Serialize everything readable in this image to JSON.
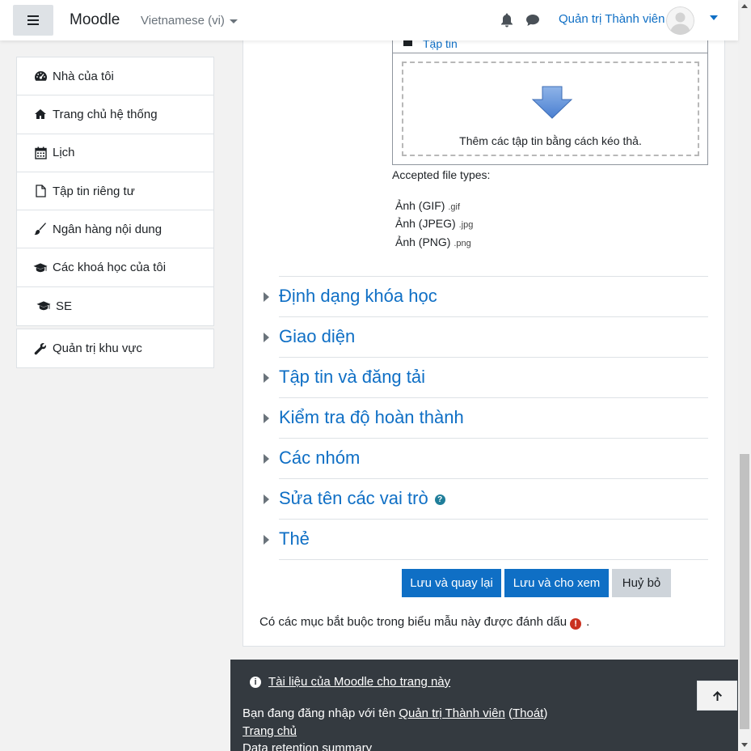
{
  "navbar": {
    "brand": "Moodle",
    "language": "Vietnamese (vi)",
    "user_name": "Quản trị Thành viên"
  },
  "drawer": {
    "items": [
      {
        "label": "Nhà của tôi",
        "icon": "dashboard-icon"
      },
      {
        "label": "Trang chủ hệ thống",
        "icon": "home-icon"
      },
      {
        "label": "Lịch",
        "icon": "calendar-icon"
      },
      {
        "label": "Tập tin riêng tư",
        "icon": "file-icon"
      },
      {
        "label": "Ngân hàng nội dung",
        "icon": "paintbrush-icon"
      },
      {
        "label": "Các khoá học của tôi",
        "icon": "graduation-cap-icon"
      },
      {
        "label": "SE",
        "icon": "graduation-cap-icon"
      }
    ],
    "admin_item": {
      "label": "Quản trị khu vực",
      "icon": "wrench-icon"
    }
  },
  "filepicker": {
    "folder_label": "Tập tin",
    "drop_text": "Thêm các tập tin bằng cách kéo thả.",
    "accepted_label": "Accepted file types:",
    "types": [
      {
        "name": "Ảnh (GIF)",
        "ext": ".gif"
      },
      {
        "name": "Ảnh (JPEG)",
        "ext": ".jpg"
      },
      {
        "name": "Ảnh (PNG)",
        "ext": ".png"
      }
    ]
  },
  "sections": [
    {
      "title": "Định dạng khóa học"
    },
    {
      "title": "Giao diện"
    },
    {
      "title": "Tập tin và đăng tải"
    },
    {
      "title": "Kiểm tra độ hoàn thành"
    },
    {
      "title": "Các nhóm"
    },
    {
      "title": "Sửa tên các vai trò"
    },
    {
      "title": "Thẻ"
    }
  ],
  "buttons": {
    "save_return": "Lưu và quay lại",
    "save_display": "Lưu và cho xem",
    "cancel": "Huỷ bỏ"
  },
  "required_note": "Có các mục bắt buộc trong biểu mẫu này được đánh dấu",
  "required_suffix": ".",
  "footer": {
    "doc_link": "Tài liệu của Moodle cho trang này",
    "logged_in_prefix": "Bạn đang đăng nhập với tên",
    "logged_in_user": "Quản trị Thành viên",
    "logout_open": "(",
    "logout": "Thoát",
    "logout_close": ")",
    "home": "Trang chủ",
    "data_retention": "Data retention summary"
  },
  "colors": {
    "primary": "#0f6fc5",
    "footer_bg": "#343a40",
    "required": "#ca3120",
    "help": "#1f7e9a"
  }
}
